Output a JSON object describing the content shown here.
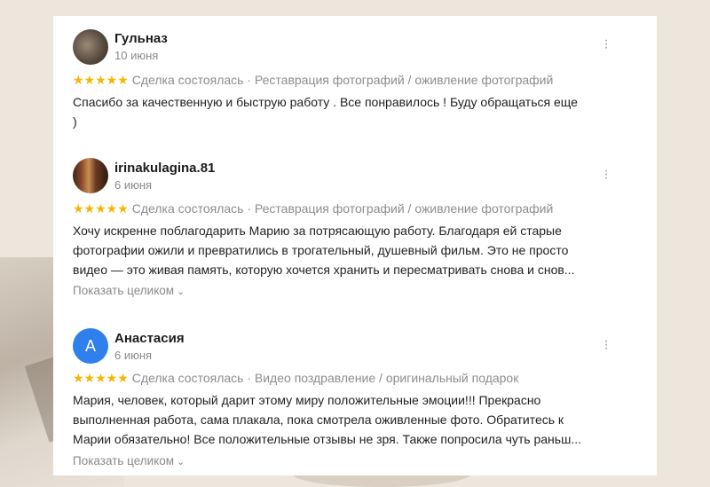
{
  "reviews": [
    {
      "author": "Гульназ",
      "date": "10 июня",
      "rating": 5,
      "stars": "★★★★★",
      "meta": "Сделка состоялась · Реставрация фотографий / оживление фотографий",
      "text": [
        "Спасибо за качественную и быструю работу . Все понравилось ! Буду обращаться еще",
        ")"
      ],
      "more": ""
    },
    {
      "author": "irinakulagina.81",
      "date": "6 июня",
      "rating": 5,
      "stars": "★★★★★",
      "meta": "Сделка состоялась · Реставрация фотографий / оживление фотографий",
      "text": [
        "Хочу искренне поблагодарить Марию за потрясающую работу. Благодаря ей старые",
        "фотографии ожили и превратились в трогательный, душевный фильм. Это не просто",
        "видео — это живая память, которую хочется хранить и пересматривать снова и снов..."
      ],
      "more": "Показать целиком"
    },
    {
      "author": "Анастасия",
      "avatar_letter": "А",
      "date": "6 июня",
      "rating": 5,
      "stars": "★★★★★",
      "meta": "Сделка состоялась · Видео поздравление / оригинальный подарок",
      "text": [
        "Мария, человек, который дарит этому миру положительные эмоции!!! Прекрасно",
        "выполненная работа, сама плакала, пока смотрела оживленные фото. Обратитесь к",
        "Марии обязательно! Все положительные отзывы не зря. Также попросила чуть раньш..."
      ],
      "more": "Показать целиком"
    }
  ],
  "icons": {
    "menu": "more-vertical-icon",
    "expand": "chevron-down-icon"
  },
  "colors": {
    "star": "#f7b500",
    "avatar_blue": "#2f80ed",
    "meta": "#8d8d8d"
  }
}
